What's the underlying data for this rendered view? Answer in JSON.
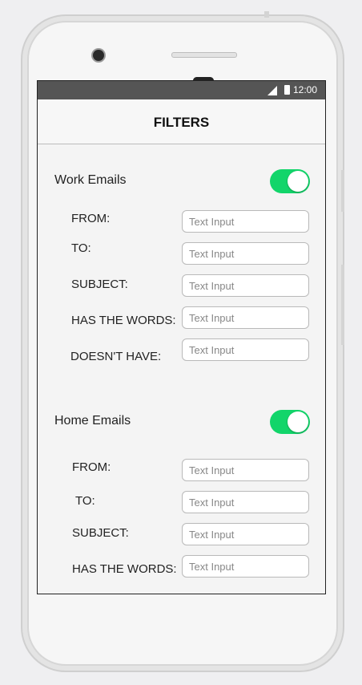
{
  "status_bar": {
    "time": "12:00"
  },
  "app_bar": {
    "title": "FILTERS"
  },
  "sections": [
    {
      "label": "Work Emails",
      "toggle_on": true,
      "fields": [
        {
          "label": "FROM:",
          "placeholder": "Text Input"
        },
        {
          "label": "TO:",
          "placeholder": "Text Input"
        },
        {
          "label": "SUBJECT:",
          "placeholder": "Text Input"
        },
        {
          "label": "HAS THE WORDS:",
          "placeholder": "Text Input"
        },
        {
          "label": "DOESN'T HAVE:",
          "placeholder": "Text Input"
        }
      ]
    },
    {
      "label": "Home Emails",
      "toggle_on": true,
      "fields": [
        {
          "label": "FROM:",
          "placeholder": "Text Input"
        },
        {
          "label": "TO:",
          "placeholder": "Text Input"
        },
        {
          "label": "SUBJECT:",
          "placeholder": "Text Input"
        },
        {
          "label": "HAS THE WORDS:",
          "placeholder": "Text Input"
        }
      ]
    }
  ],
  "colors": {
    "toggle_on": "#12d56a",
    "status_bar": "#555555"
  }
}
